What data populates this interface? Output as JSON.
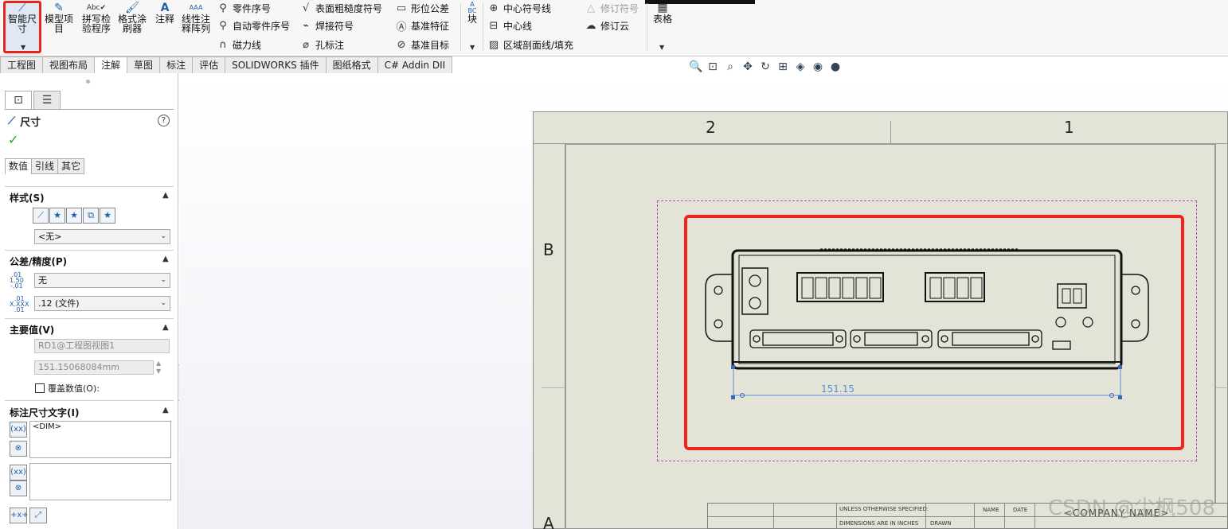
{
  "ribbon": {
    "smart_dimension": "智能尺\n寸",
    "model_items": "模型项\n目",
    "spell_check": "拼写检\n验程序",
    "format_painter": "格式涂\n刷器",
    "note": "注释",
    "linear_note_pattern": "线性注\n释阵列",
    "balloon": "零件序号",
    "auto_balloon": "自动零件序号",
    "magnetic_line": "磁力线",
    "surface_finish": "表面粗糙度符号",
    "weld_symbol": "焊接符号",
    "hole_callout": "孔标注",
    "gtol": "形位公差",
    "datum_feature": "基准特征",
    "datum_target": "基准目标",
    "block_abc": "A\nBC",
    "block": "块",
    "center_mark": "中心符号线",
    "centerline": "中心线",
    "area_hatch": "区域剖面线/填充",
    "revision_symbol": "修订符号",
    "revision_cloud": "修订云",
    "table": "表格"
  },
  "tabs": [
    "工程图",
    "视图布局",
    "注解",
    "草图",
    "标注",
    "评估",
    "SOLIDWORKS 插件",
    "图纸格式",
    "C# Addin DII"
  ],
  "active_tab_index": 2,
  "panel": {
    "title": "尺寸",
    "help": "?",
    "ok": "✓",
    "subtabs": [
      "数值",
      "引线",
      "其它"
    ],
    "style_section": "样式(S)",
    "style_value": "<无>",
    "tolerance_section": "公差/精度(P)",
    "tolerance_value": "无",
    "precision_value": ".12 (文件)",
    "tol_icon_text": ".01\n1.50\n-.01",
    "prec_icon_text": ".01\nX.XXX\n.01",
    "primary_section": "主要值(V)",
    "primary_name": "RD1@工程图视图1",
    "primary_value": "151.15068084mm",
    "override_label": "覆盖数值(O):",
    "dim_text_section": "标注尺寸文字(I)",
    "dim_text": "<DIM>"
  },
  "drawing": {
    "zone_top_left": "2",
    "zone_top_right": "1",
    "zone_left_b": "B",
    "zone_left_a": "A",
    "dimension_value": "151.15",
    "title_block": {
      "unless": "UNLESS OTHERWISE SPECIFIED:",
      "dims": "DIMENSIONS ARE IN INCHES",
      "drawn": "DRAWN",
      "name": "NAME",
      "date": "DATE",
      "company": "<COMPANY NAME>"
    }
  },
  "watermark": "CSDN @尘枫508",
  "colors": {
    "highlight_red": "#f02418",
    "sheet_bg": "#e4e3d8",
    "view_box_magenta": "#c83ec8",
    "dimension_blue": "#5b8fd0"
  }
}
